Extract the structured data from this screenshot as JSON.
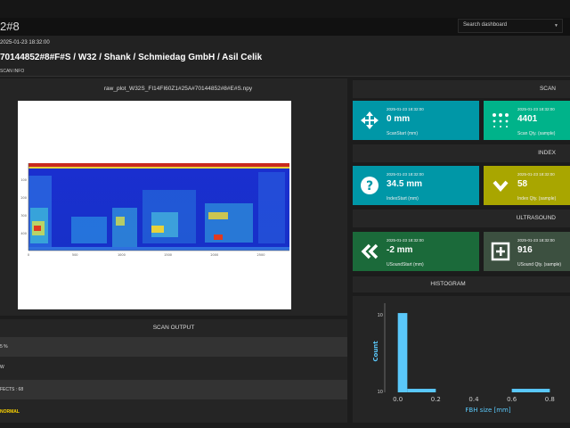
{
  "dashboard": {
    "title": "2#8",
    "search_placeholder": "Search dashboard"
  },
  "header": {
    "date": "2025-01-23 18:32:00",
    "title": "70144852#8#F#S / W32 / Shank / Schmiedag GmbH / Asil Celik",
    "info_label": "SCAN INFO"
  },
  "plot": {
    "title": "raw_plot_W32S_FI14FI60Z1#25A#70144852#8#E#S.npy",
    "x_ticks": [
      "0",
      "500",
      "1000",
      "1500",
      "2000",
      "2500"
    ],
    "y_ticks": [
      "100",
      "200",
      "300",
      "400"
    ]
  },
  "scan_output": {
    "title": "SCAN OUTPUT",
    "rows": [
      {
        "text": "5 %",
        "color": "#dddddd"
      },
      {
        "text": "W",
        "color": "#dddddd"
      },
      {
        "text": "FECTS : 68",
        "color": "#dddddd"
      },
      {
        "text": "NORMAL",
        "color": "#ffd600"
      }
    ]
  },
  "sections": {
    "scan": "SCAN",
    "index": "INDEX",
    "ultrasound": "ULTRASOUND",
    "histogram": "HISTOGRAM"
  },
  "cards": {
    "scan_start": {
      "ts": "2025-01-23 18:32:00",
      "value": "0 mm",
      "label": "ScanStart (mm)",
      "color": "#0097a7",
      "icon": "move-arrows-icon"
    },
    "scan_qty": {
      "ts": "2025-01-23 18:32:00",
      "value": "4401",
      "label": "Scan Qty. (sample)",
      "color": "#00b38a",
      "icon": "grid-dots-icon"
    },
    "index_start": {
      "ts": "2025-01-23 18:32:00",
      "value": "34.5 mm",
      "label": "IndexStart (mm)",
      "color": "#0097a7",
      "icon": "question-circle-icon"
    },
    "index_qty": {
      "ts": "2025-01-23 18:32:00",
      "value": "58",
      "label": "Index Qty. (sample)",
      "color": "#a9a600",
      "icon": "chevron-down-icon"
    },
    "usound_start": {
      "ts": "2025-01-23 18:32:00",
      "value": "-2 mm",
      "label": "USoundStart (mm)",
      "color": "#1b6a3a",
      "icon": "double-chevron-left-icon"
    },
    "usound_qty": {
      "ts": "2025-01-23 18:32:00",
      "value": "916",
      "label": "USound Qty. (sample)",
      "color": "#3c5040",
      "icon": "plus-square-icon"
    }
  },
  "chart_data": {
    "type": "bar",
    "title": "",
    "xlabel": "FBH size [mm]",
    "ylabel": "Count",
    "x_ticks": [
      "0.0",
      "0.2",
      "0.4",
      "0.6",
      "0.8"
    ],
    "xlim": [
      -0.05,
      0.85
    ],
    "y_scale": "log",
    "y_tick_labels": [
      "10",
      "10"
    ],
    "bars": [
      {
        "x0": 0.0,
        "x1": 0.05,
        "value": 60
      },
      {
        "x0": 0.05,
        "x1": 0.2,
        "value": 1.2
      },
      {
        "x0": 0.6,
        "x1": 0.8,
        "value": 1.2
      }
    ],
    "ylim": [
      1,
      100
    ],
    "bar_color": "#5ac8fa",
    "grid": false
  }
}
